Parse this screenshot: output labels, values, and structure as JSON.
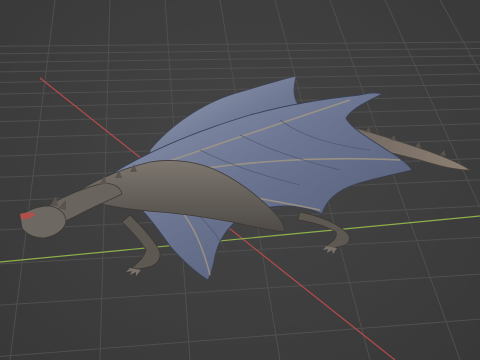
{
  "viewport": {
    "mode": "3d-viewport",
    "object": "dragon-model",
    "shading": "textured",
    "grid": true,
    "axes": {
      "x_axis_color": "#b54a4a",
      "y_axis_color": "#8db04a"
    },
    "colors": {
      "background": "#3d3d3d",
      "grid_line": "#4f4f4f",
      "wing_membrane": "#6f7a96",
      "wing_bone": "#9a8f7a",
      "body": "#6b6560",
      "mouth": "#b0504a"
    }
  }
}
